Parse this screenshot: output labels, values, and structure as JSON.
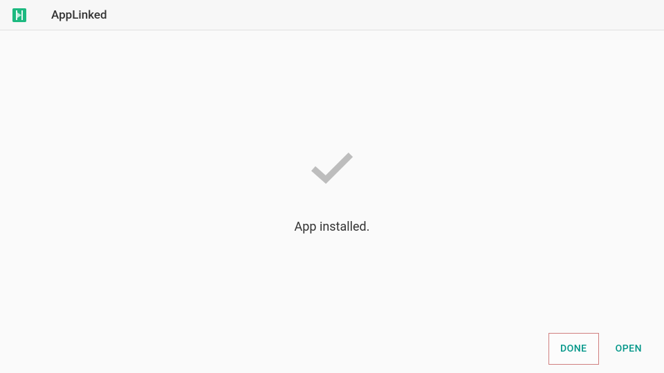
{
  "header": {
    "app_title": "AppLinked",
    "app_icon_name": "applinked-icon"
  },
  "main": {
    "status_icon": "checkmark-icon",
    "status_text": "App installed."
  },
  "buttons": {
    "done": "DONE",
    "open": "OPEN"
  },
  "colors": {
    "accent": "#009688",
    "icon_bg": "#1db980"
  }
}
